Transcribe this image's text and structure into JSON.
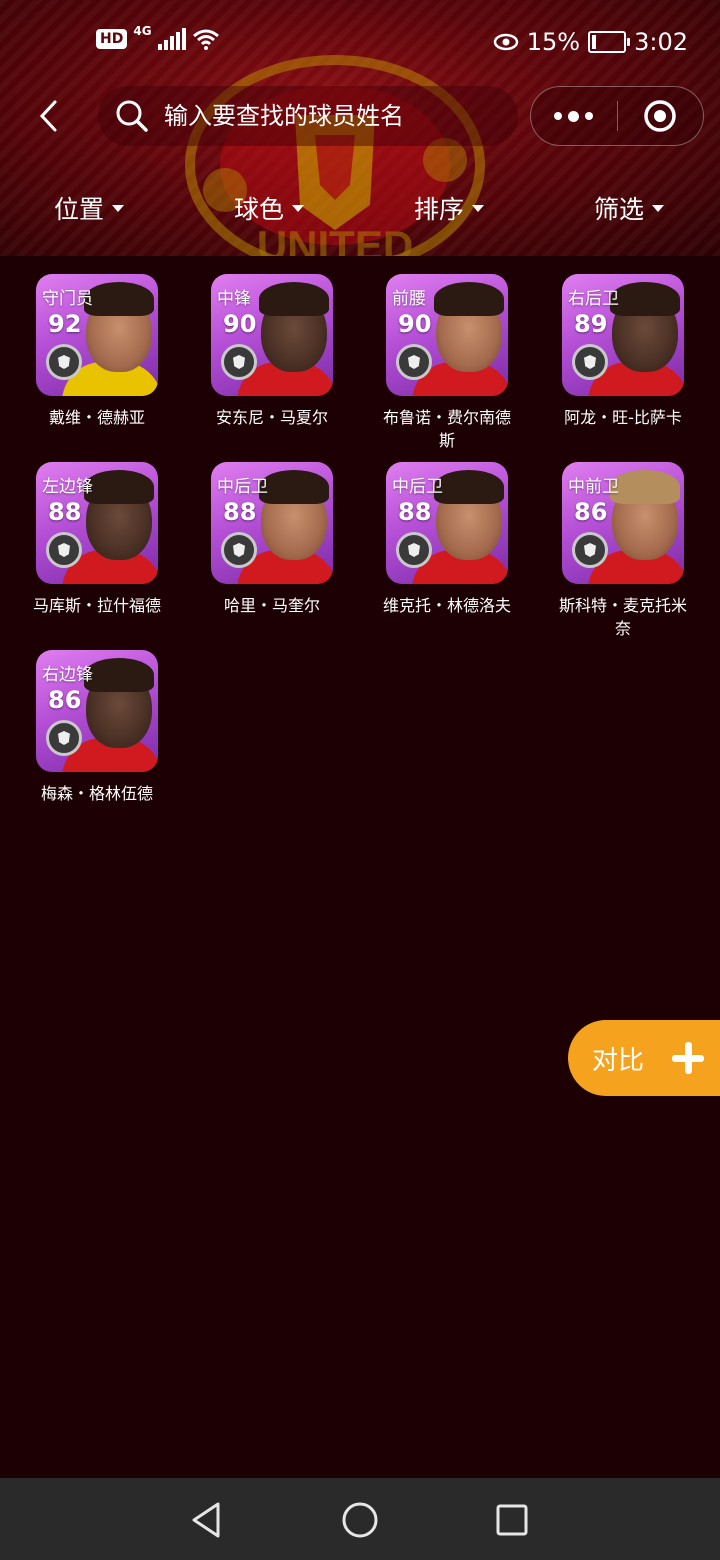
{
  "status": {
    "network_badge": "HD",
    "network_type": "4G",
    "battery_percent": "15%",
    "battery_level": 0.15,
    "time": "3:02"
  },
  "icons": {
    "back": "chevron-left-icon",
    "search": "search-icon",
    "more": "more-dots-icon",
    "close": "target-close-icon",
    "eye": "eye-icon",
    "compare": "plus-icon"
  },
  "search": {
    "placeholder": "输入要查找的球员姓名"
  },
  "filters": [
    {
      "label": "位置"
    },
    {
      "label": "球色"
    },
    {
      "label": "排序"
    },
    {
      "label": "筛选"
    }
  ],
  "players": [
    {
      "position": "守门员",
      "rating": "92",
      "name": "戴维・德赫亚"
    },
    {
      "position": "中锋",
      "rating": "90",
      "name": "安东尼・马夏尔"
    },
    {
      "position": "前腰",
      "rating": "90",
      "name": "布鲁诺・费尔南德斯"
    },
    {
      "position": "右后卫",
      "rating": "89",
      "name": "阿龙・旺-比萨卡"
    },
    {
      "position": "左边锋",
      "rating": "88",
      "name": "马库斯・拉什福德"
    },
    {
      "position": "中后卫",
      "rating": "88",
      "name": "哈里・马奎尔"
    },
    {
      "position": "中后卫",
      "rating": "88",
      "name": "维克托・林德洛夫"
    },
    {
      "position": "中前卫",
      "rating": "86",
      "name": "斯科特・麦克托米奈"
    },
    {
      "position": "右边锋",
      "rating": "86",
      "name": "梅森・格林伍德"
    }
  ],
  "compare": {
    "label": "对比"
  },
  "colors": {
    "background": "#1c0003",
    "card_purple": "#b44fd6",
    "compare_orange": "#f5a21e",
    "navbar": "#2a2a2a"
  }
}
